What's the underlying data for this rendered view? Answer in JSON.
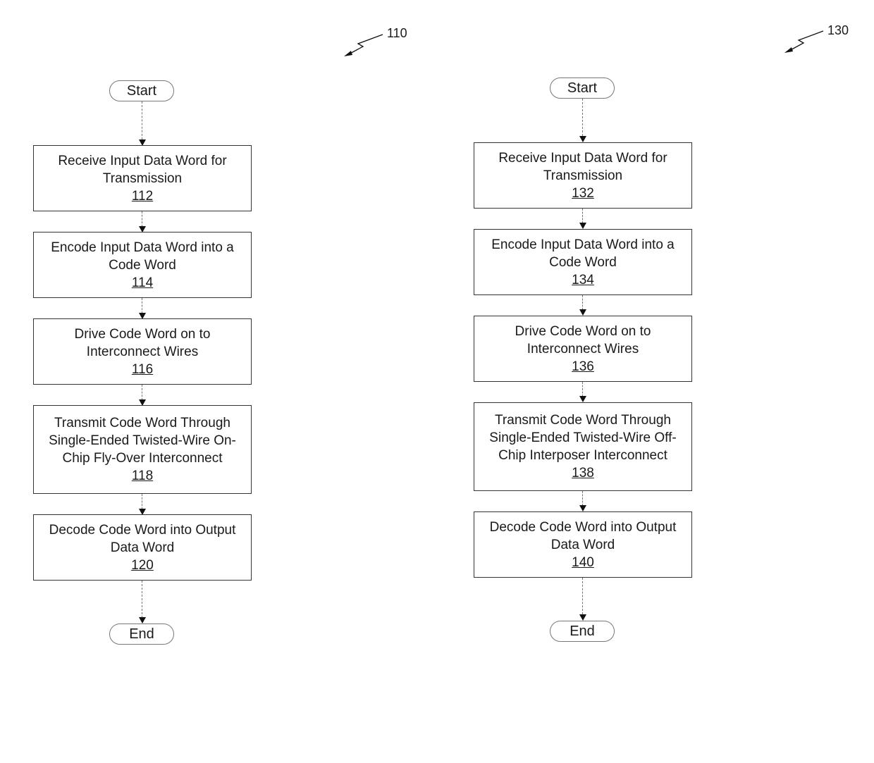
{
  "flows": [
    {
      "ref": "110",
      "start": "Start",
      "end": "End",
      "steps": [
        {
          "text": "Receive Input Data Word for Transmission",
          "num": "112"
        },
        {
          "text": "Encode Input Data Word into a Code Word",
          "num": "114"
        },
        {
          "text": "Drive Code Word on to Interconnect Wires",
          "num": "116"
        },
        {
          "text": "Transmit Code Word Through Single-Ended Twisted-Wire On-Chip Fly-Over Interconnect",
          "num": "118"
        },
        {
          "text": "Decode Code Word into Output Data Word",
          "num": "120"
        }
      ]
    },
    {
      "ref": "130",
      "start": "Start",
      "end": "End",
      "steps": [
        {
          "text": "Receive Input Data Word for Transmission",
          "num": "132"
        },
        {
          "text": "Encode Input Data Word into a Code Word",
          "num": "134"
        },
        {
          "text": "Drive Code Word on to Interconnect Wires",
          "num": "136"
        },
        {
          "text": "Transmit Code Word Through Single-Ended Twisted-Wire Off-Chip Interposer Interconnect",
          "num": "138"
        },
        {
          "text": "Decode Code Word into Output Data Word",
          "num": "140"
        }
      ]
    }
  ]
}
